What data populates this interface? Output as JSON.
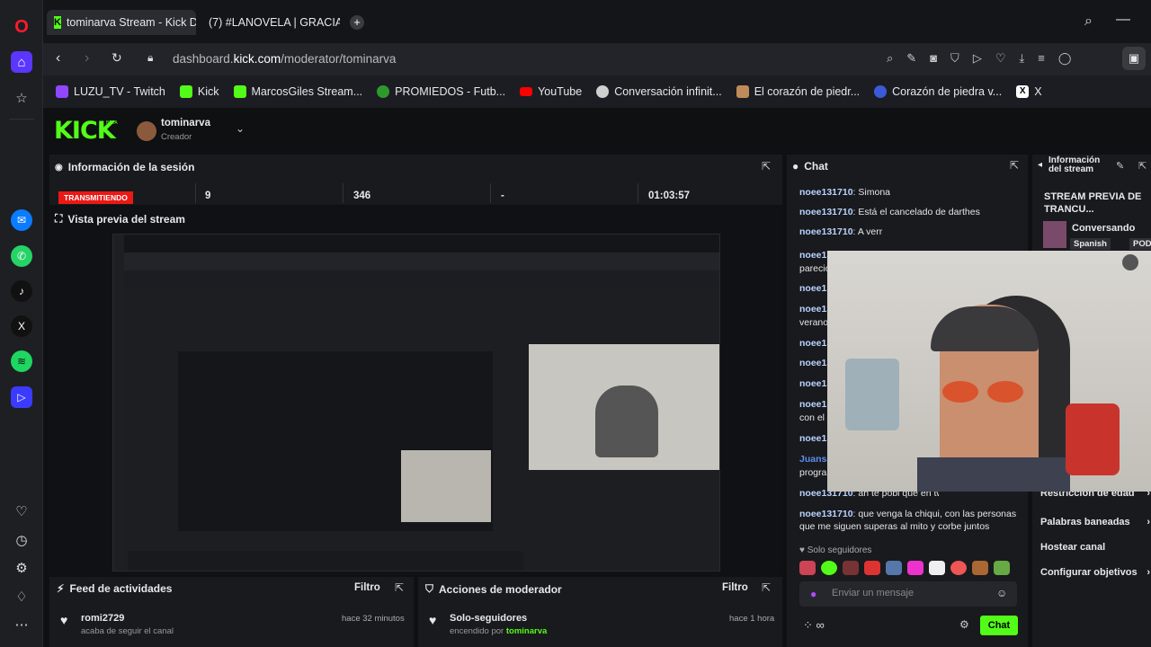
{
  "opera_sidebar": {
    "icons": [
      "opera-logo-icon",
      "home-icon",
      "star-icon",
      "messenger-icon",
      "whatsapp-icon",
      "tiktok-icon",
      "x-icon",
      "spotify-icon",
      "player-icon",
      "heart-icon",
      "history-icon",
      "settings-icon",
      "lightbulb-icon",
      "more-icon"
    ]
  },
  "tabs": [
    {
      "title": "tominarva Stream - Kick D"
    },
    {
      "title": "(7) #LANOVELA | GRACIAS"
    }
  ],
  "address": {
    "prefix": "dashboard.",
    "domain": "kick.com",
    "path": "/moderator/tominarva"
  },
  "bookmarks": [
    {
      "label": "LUZU_TV - Twitch",
      "color": "#9146ff"
    },
    {
      "label": "Kick",
      "color": "#53fc18"
    },
    {
      "label": "MarcosGiles Stream...",
      "color": "#53fc18"
    },
    {
      "label": "PROMIEDOS - Futb...",
      "color": "#2e9a2e"
    },
    {
      "label": "YouTube",
      "color": "#ff0000"
    },
    {
      "label": "Conversación infinit...",
      "color": "#cfcfcf"
    },
    {
      "label": "El corazón de piedr...",
      "color": "#c08a5a"
    },
    {
      "label": "Corazón de piedra v...",
      "color": "#3b5bd6"
    },
    {
      "label": "X",
      "color": "#111111"
    }
  ],
  "kick": {
    "logo": "KICK",
    "beta": "BETA",
    "user": "tominarva",
    "role": "Creador"
  },
  "session": {
    "title": "Información de la sesión",
    "status": "TRANSMITIENDO",
    "stat1": "9",
    "stat2": "346",
    "stat3": "-",
    "time": "01:03:57"
  },
  "preview": {
    "title": "Vista previa del stream"
  },
  "activity": {
    "title": "Feed de actividades",
    "filter": "Filtro",
    "user": "romi2729",
    "action": "acaba de seguir el canal",
    "time": "hace 32 minutos"
  },
  "modactions": {
    "title": "Acciones de moderador",
    "filter": "Filtro",
    "action": "Solo-seguidores",
    "by_prefix": "encendido por",
    "by_user": "tominarva",
    "time": "hace 1 hora"
  },
  "chat": {
    "title": "Chat",
    "messages": [
      {
        "user": "noee131710",
        "text": "Simona"
      },
      {
        "user": "noee131710",
        "text": "Está el cancelado de darthes"
      },
      {
        "user": "noee131710",
        "text": "A verr"
      }
    ],
    "partial_users": [
      "noee13",
      "noee13",
      "noee13",
      "noee13",
      "noee13",
      "noee13",
      "noee13",
      "noee13",
      "Juansa"
    ],
    "partial_texts": [
      "parecio",
      "verano",
      "con el",
      "progra"
    ],
    "line_cut": "ah te pobl que en tw",
    "last_user": "noee131710",
    "last_text": "que venga la chiqui, con las personas que me siguen superas al mito y corbe juntos",
    "followers_only": "Solo seguidores",
    "placeholder": "Enviar un mensaje",
    "send": "Chat"
  },
  "stream_info": {
    "title": "Información del stream",
    "stream_title": "STREAM PREVIA DE TRANCU...",
    "category": "Conversando",
    "tag1": "Spanish",
    "tag2": "POD",
    "items": [
      "Restricción de edad",
      "Palabras baneadas",
      "Hostear canal",
      "Configurar objetivos"
    ]
  },
  "colors": {
    "kick_green": "#53fc18",
    "live_red": "#e91916"
  }
}
